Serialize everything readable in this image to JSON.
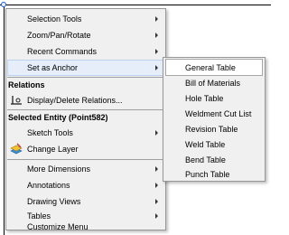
{
  "main_menu": {
    "items": [
      {
        "label": "Selection Tools",
        "has_submenu": true
      },
      {
        "label": "Zoom/Pan/Rotate",
        "has_submenu": true
      },
      {
        "label": "Recent Commands",
        "has_submenu": true
      },
      {
        "label": "Set as Anchor",
        "has_submenu": true,
        "highlighted": true
      }
    ],
    "relations": {
      "header": "Relations",
      "display_delete_label": "Display/Delete Relations..."
    },
    "selected_entity": {
      "header": "Selected Entity (Point582)",
      "items": [
        {
          "label": "Sketch Tools",
          "has_submenu": true
        },
        {
          "label": "Change Layer",
          "has_submenu": false
        },
        {
          "label": "More Dimensions",
          "has_submenu": true
        },
        {
          "label": "Annotations",
          "has_submenu": true
        },
        {
          "label": "Drawing Views",
          "has_submenu": true
        },
        {
          "label": "Tables",
          "has_submenu": true
        },
        {
          "label": "Customize Menu",
          "has_submenu": false
        }
      ]
    }
  },
  "set_as_anchor_submenu": {
    "items": [
      {
        "label": "General Table",
        "highlighted": true
      },
      {
        "label": "Bill of Materials"
      },
      {
        "label": "Hole Table"
      },
      {
        "label": "Weldment Cut List"
      },
      {
        "label": "Revision Table"
      },
      {
        "label": "Weld Table"
      },
      {
        "label": "Bend Table"
      },
      {
        "label": "Punch Table"
      }
    ]
  },
  "colors": {
    "menu_background": "#f0f0f0",
    "menu_border": "#979797",
    "highlight_background": "#e5eef9",
    "highlight_border": "#bcd1ee",
    "point_handle": "#1a5fd6"
  },
  "icons": {
    "display_delete_relations": "relations-icon",
    "change_layer": "layer-icon",
    "submenu_arrow": "chevron-right-icon"
  }
}
